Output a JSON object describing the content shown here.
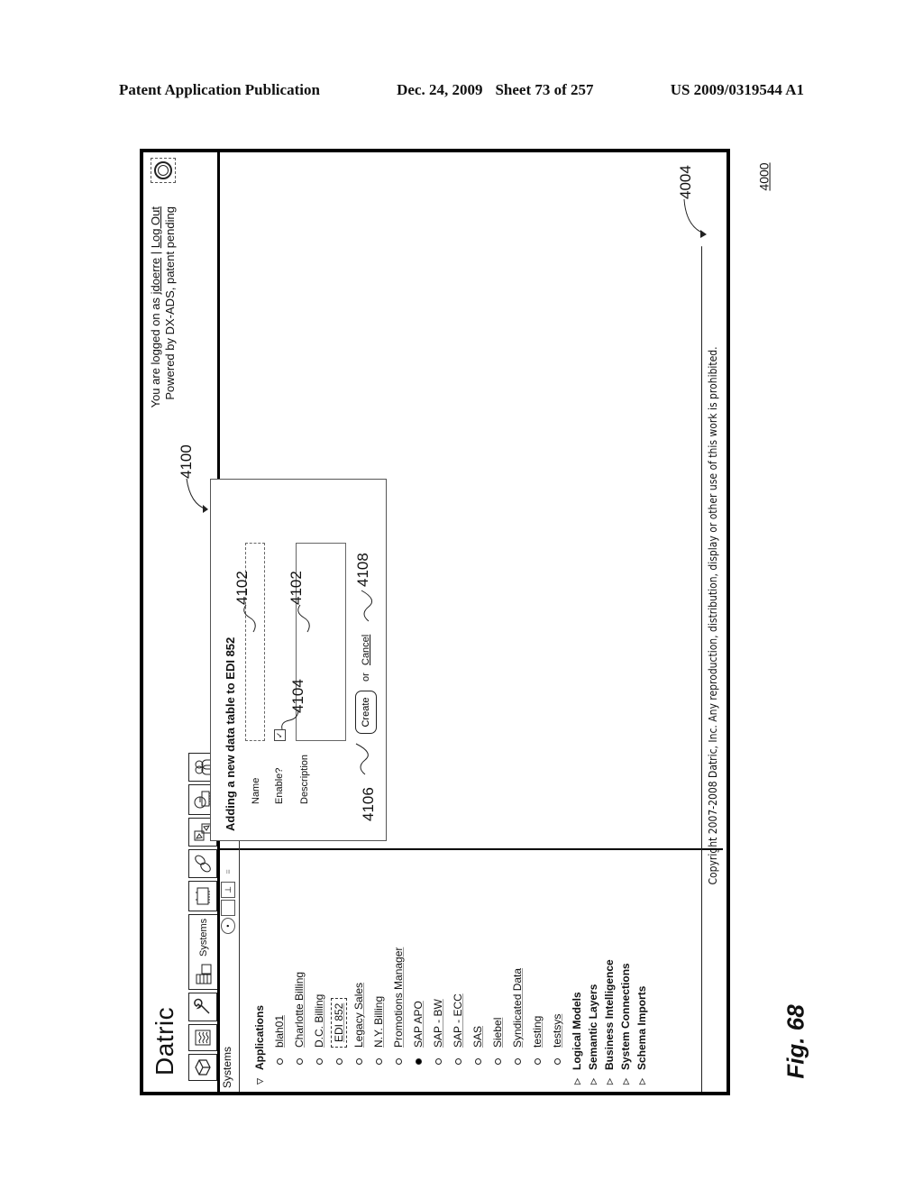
{
  "publication_header": {
    "left": "Patent Application Publication",
    "date": "Dec. 24, 2009",
    "sheet": "Sheet 73 of 257",
    "number": "US 2009/0319544 A1"
  },
  "figure": {
    "label": "Fig. 68",
    "ref_number": "4000"
  },
  "app": {
    "brand": "Datric",
    "session": {
      "prefix": "You are logged on as",
      "username": "jdoerre",
      "separator": "|",
      "logout_label": "Log Out",
      "powered_by": "Powered by DX-ADS, patent pending"
    },
    "help_icon": "help-ring-icon",
    "toolbar": [
      {
        "icon": "cube-icon",
        "label": ""
      },
      {
        "icon": "wave-chart-icon",
        "label": ""
      },
      {
        "icon": "wrench-icon",
        "label": ""
      },
      {
        "icon": "systems-grid-icon",
        "label": "Systems",
        "active": true
      },
      {
        "icon": "chip-icon",
        "label": ""
      },
      {
        "icon": "link-icon",
        "label": ""
      },
      {
        "icon": "transform-icon",
        "label": ""
      },
      {
        "icon": "pie-chip-icon",
        "label": ""
      },
      {
        "icon": "users-icon",
        "label": ""
      }
    ],
    "sidebar": {
      "title": "Systems",
      "subtools": [
        "disc-icon",
        "page-icon",
        "tree-icon",
        "list-icon"
      ],
      "tree": {
        "root": {
          "label": "Applications",
          "expanded": true
        },
        "items": [
          {
            "label": "blah01",
            "selected": false,
            "filled": false
          },
          {
            "label": "Charlotte Billing",
            "selected": false,
            "filled": false
          },
          {
            "label": "D.C. Billing",
            "selected": false,
            "filled": false
          },
          {
            "label": "EDI 852",
            "selected": true,
            "filled": false
          },
          {
            "label": "Legacy Sales",
            "selected": false,
            "filled": false
          },
          {
            "label": "N.Y. Billing",
            "selected": false,
            "filled": false
          },
          {
            "label": "Promotions Manager",
            "selected": false,
            "filled": false
          },
          {
            "label": "SAP APO",
            "selected": false,
            "filled": true
          },
          {
            "label": "SAP - BW",
            "selected": false,
            "filled": false
          },
          {
            "label": "SAP - ECC",
            "selected": false,
            "filled": false
          },
          {
            "label": "SAS",
            "selected": false,
            "filled": false
          },
          {
            "label": "Siebel",
            "selected": false,
            "filled": false
          },
          {
            "label": "Syndicated Data",
            "selected": false,
            "filled": false
          },
          {
            "label": "testing",
            "selected": false,
            "filled": false
          },
          {
            "label": "testsys",
            "selected": false,
            "filled": false
          }
        ],
        "groups": [
          "Logical Models",
          "Semantic Layers",
          "Business Intelligence",
          "System Connections",
          "Schema Imports"
        ]
      }
    },
    "dialog": {
      "title": "Adding a new data table to EDI 852",
      "name_label": "Name",
      "name_value": "",
      "enable_label": "Enable?",
      "enable_checked": true,
      "description_label": "Description",
      "description_value": "",
      "create_label": "Create",
      "or_label": "or",
      "cancel_label": "Cancel"
    },
    "footer": "Copyright 2007-2008 Datric, Inc.  Any reproduction, distribution, display or other use of this work is prohibited."
  },
  "reference_numerals": {
    "dialog": "4100",
    "name_field": "4102",
    "description_field": "4102",
    "checkbox": "4104",
    "create_button": "4106",
    "cancel_link": "4108",
    "content_area": "4004"
  }
}
